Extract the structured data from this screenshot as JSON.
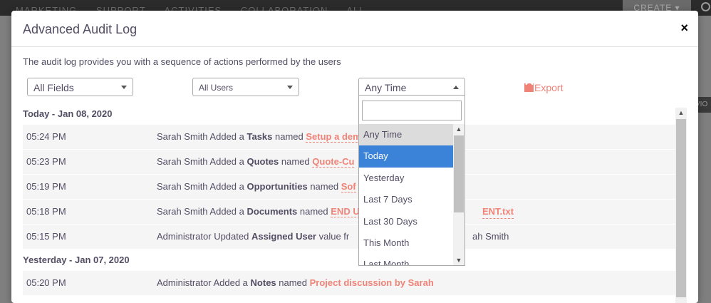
{
  "background": {
    "nav": [
      "MARKETING",
      "SUPPORT",
      "ACTIVITIES",
      "COLLABORATION",
      "ALL"
    ],
    "create_label": "CREATE",
    "side_tab": "VIO"
  },
  "modal": {
    "title": "Advanced Audit Log",
    "close_label": "×",
    "description": "The audit log provides you with a sequence of actions performed by the users",
    "filters": {
      "fields": "All Fields",
      "users": "All Users",
      "time": "Any Time"
    },
    "export_label": "Export",
    "groups": [
      {
        "header": "Today - Jan 08, 2020",
        "rows": [
          {
            "time": "05:24 PM",
            "prefix": "Sarah Smith Added a ",
            "module": "Tasks",
            "middle": " named ",
            "link": "Setup a dem"
          },
          {
            "time": "05:23 PM",
            "prefix": "Sarah Smith Added a ",
            "module": "Quotes",
            "middle": " named ",
            "link": "Quote-Cu"
          },
          {
            "time": "05:19 PM",
            "prefix": "Sarah Smith Added a ",
            "module": "Opportunities",
            "middle": " named ",
            "link": "Sof"
          },
          {
            "time": "05:18 PM",
            "prefix": "Sarah Smith Added a ",
            "module": "Documents",
            "middle": " named ",
            "link": "END U",
            "link_tail": "ENT.txt"
          },
          {
            "time": "05:15 PM",
            "prefix": "Administrator Updated ",
            "module": "Assigned User",
            "middle": " value fr",
            "tail": "ah Smith"
          }
        ]
      },
      {
        "header": "Yesterday - Jan 07, 2020",
        "rows": [
          {
            "time": "05:20 PM",
            "prefix": "Administrator Added a ",
            "module": "Notes",
            "middle": " named ",
            "link": "Project discussion by Sarah"
          }
        ]
      }
    ],
    "time_dropdown": {
      "search_value": "",
      "options": [
        "Any Time",
        "Today",
        "Yesterday",
        "Last 7 Days",
        "Last 30 Days",
        "This Month",
        "Last Month"
      ],
      "selected": "Any Time",
      "highlighted": "Today"
    }
  },
  "colors": {
    "accent": "#f08377",
    "highlight": "#3b83d9",
    "text": "#534d64",
    "row_bg": "#f5f5f5"
  }
}
